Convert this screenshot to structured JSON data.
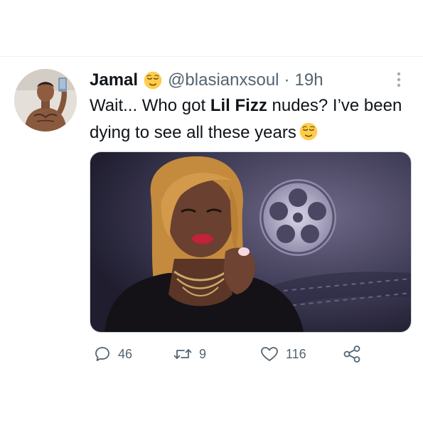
{
  "tweet": {
    "author": {
      "display_name": "Jamal",
      "handle": "@blasianxsoul",
      "name_emoji": "relieved-face-icon"
    },
    "separator": "·",
    "timestamp": "19h",
    "text": {
      "part1": "Wait... Who got ",
      "bold": "Lil Fizz",
      "part2": " nudes? I’ve been dying to see all these years",
      "trailing_emoji": "relieved-face-icon"
    },
    "media": {
      "type": "image",
      "description_icon": "film-reel-icon"
    },
    "actions": {
      "replies": "46",
      "retweets": "9",
      "likes": "116",
      "share_icon": "share-icon"
    }
  },
  "colors": {
    "text_primary": "#0f1419",
    "text_secondary": "#536471",
    "divider": "#eff3f4",
    "emoji_yellow": "#ffcc4d"
  }
}
